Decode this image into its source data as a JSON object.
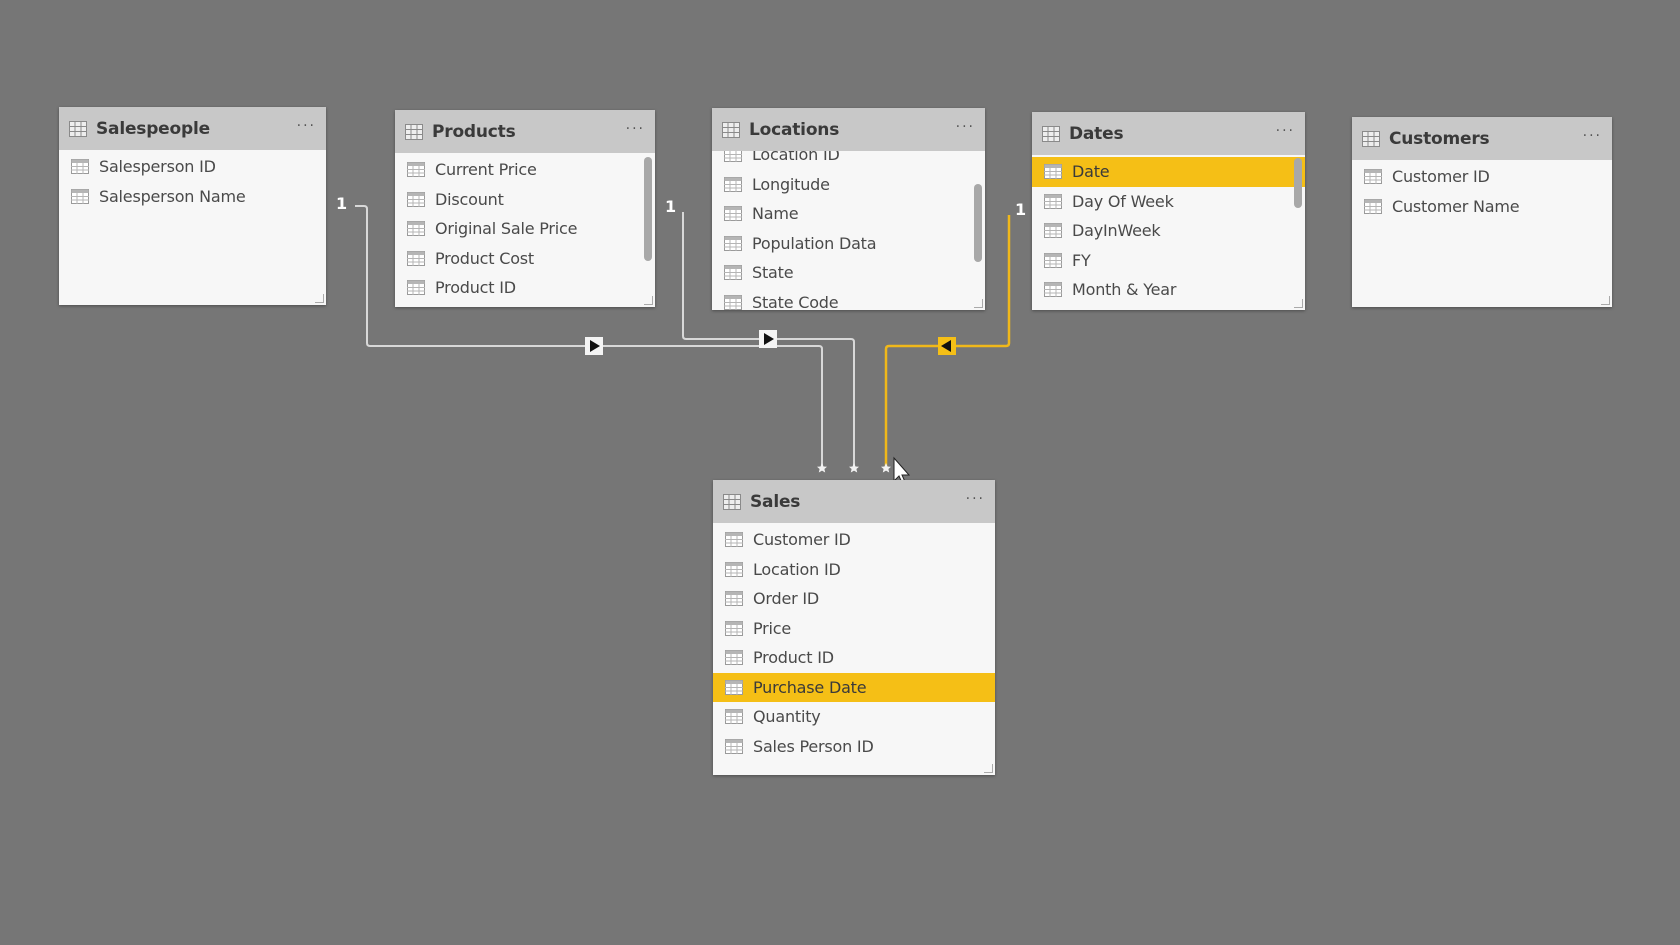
{
  "tables": [
    {
      "id": "salespeople",
      "title": "Salespeople",
      "more_label": "···",
      "fields": [
        {
          "name": "Salesperson ID"
        },
        {
          "name": "Salesperson Name"
        }
      ]
    },
    {
      "id": "products",
      "title": "Products",
      "more_label": "···",
      "fields": [
        {
          "name": "Current Price"
        },
        {
          "name": "Discount"
        },
        {
          "name": "Original Sale Price"
        },
        {
          "name": "Product Cost"
        },
        {
          "name": "Product ID"
        }
      ]
    },
    {
      "id": "locations",
      "title": "Locations",
      "more_label": "···",
      "fields": [
        {
          "name": "Location ID"
        },
        {
          "name": "Longitude"
        },
        {
          "name": "Name"
        },
        {
          "name": "Population Data"
        },
        {
          "name": "State"
        },
        {
          "name": "State Code"
        }
      ]
    },
    {
      "id": "dates",
      "title": "Dates",
      "more_label": "···",
      "fields": [
        {
          "name": "Date",
          "highlighted": true
        },
        {
          "name": "Day Of Week"
        },
        {
          "name": "DayInWeek"
        },
        {
          "name": "FY"
        },
        {
          "name": "Month & Year"
        }
      ]
    },
    {
      "id": "customers",
      "title": "Customers",
      "more_label": "···",
      "fields": [
        {
          "name": "Customer ID"
        },
        {
          "name": "Customer Name"
        }
      ]
    },
    {
      "id": "sales",
      "title": "Sales",
      "more_label": "···",
      "fields": [
        {
          "name": "Customer ID"
        },
        {
          "name": "Location ID"
        },
        {
          "name": "Order ID"
        },
        {
          "name": "Price"
        },
        {
          "name": "Product ID"
        },
        {
          "name": "Purchase Date",
          "highlighted": true
        },
        {
          "name": "Quantity"
        },
        {
          "name": "Sales Person ID"
        }
      ]
    }
  ],
  "relationships": [
    {
      "from": "salespeople",
      "to": "sales",
      "one_label": "1",
      "many_label": "*",
      "direction": "single",
      "selected": false
    },
    {
      "from": "products",
      "to": "sales",
      "one_label": "1",
      "many_label": "*",
      "direction": "single",
      "selected": false
    },
    {
      "from": "dates",
      "to": "sales",
      "one_label": "1",
      "many_label": "*",
      "direction": "single",
      "selected": true
    }
  ],
  "colors": {
    "canvas": "#767676",
    "highlight": "#f5bf16",
    "line": "#d8d8d8",
    "header": "#c8c8c8"
  }
}
